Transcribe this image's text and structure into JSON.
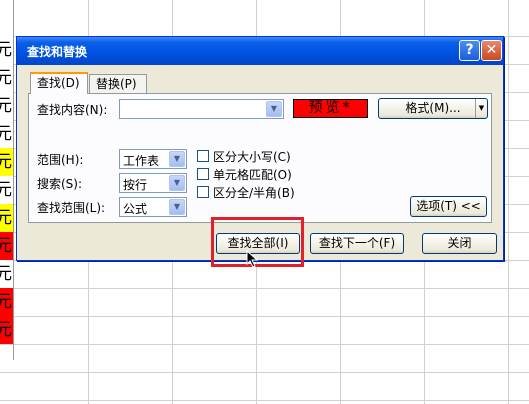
{
  "sheet": {
    "column_a_cells": [
      {
        "text": "元",
        "bg": "#ffffff"
      },
      {
        "text": "元",
        "bg": "#ffffff"
      },
      {
        "text": "元",
        "bg": "#ffffff"
      },
      {
        "text": "元",
        "bg": "#ffffff"
      },
      {
        "text": "元",
        "bg": "#ffff00"
      },
      {
        "text": "元",
        "bg": "#ffffff"
      },
      {
        "text": "元",
        "bg": "#ffff00"
      },
      {
        "text": "元",
        "bg": "#ff0000"
      },
      {
        "text": "元",
        "bg": "#ffffff"
      },
      {
        "text": "元",
        "bg": "#ff0000"
      },
      {
        "text": "元",
        "bg": "#ff0000"
      }
    ]
  },
  "dialog": {
    "title": "查找和替换",
    "help_label": "?",
    "close_label": "✕",
    "tabs": [
      {
        "label": "查找(D)",
        "active": true
      },
      {
        "label": "替换(P)",
        "active": false
      }
    ],
    "find_what_label": "查找内容(N):",
    "find_what_value": "",
    "preview_label": "预览*",
    "preview_bg": "#ff0000",
    "format_button": "格式(M)...",
    "within_label": "范围(H):",
    "within_value": "工作表",
    "search_label": "搜索(S):",
    "search_value": "按行",
    "look_in_label": "查找范围(L):",
    "look_in_value": "公式",
    "match_case_label": "区分大小写(C)",
    "match_cell_label": "单元格匹配(O)",
    "match_byte_label": "区分全/半角(B)",
    "options_button": "选项(T) <<",
    "find_all_button": "查找全部(I)",
    "find_next_button": "查找下一个(F)",
    "close_button": "关闭",
    "highlight_color": "#e0202a"
  }
}
